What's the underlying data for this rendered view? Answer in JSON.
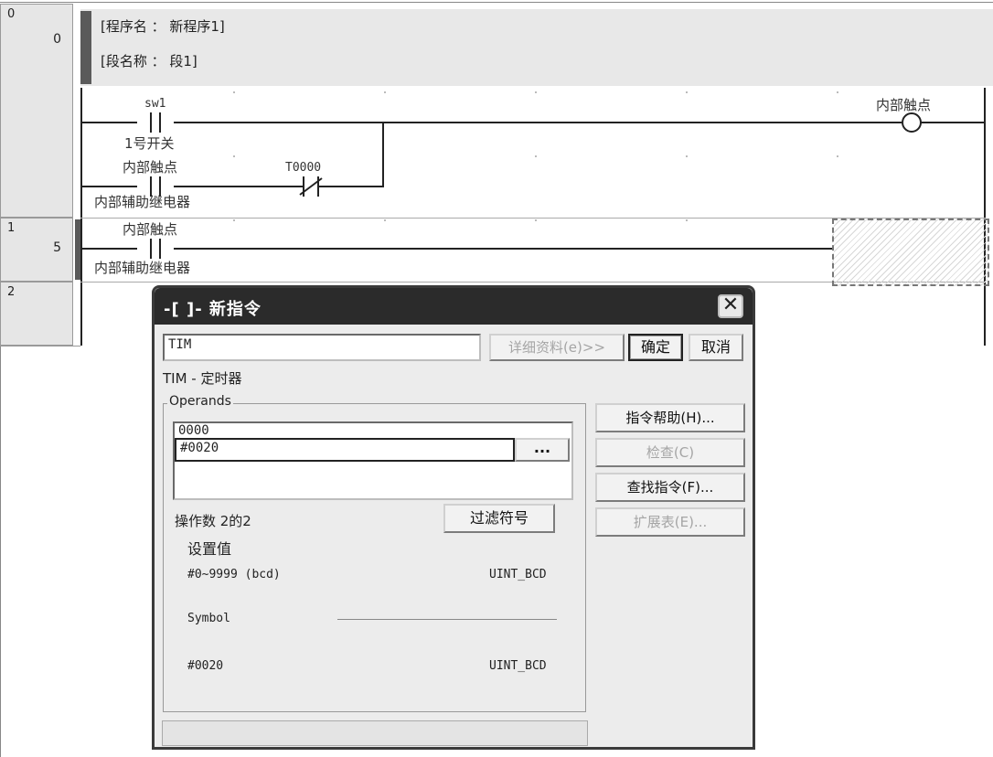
{
  "editor": {
    "rungs": [
      {
        "index": "0",
        "step": "0"
      },
      {
        "index": "1",
        "step": "5"
      },
      {
        "index": "2",
        "step": ""
      }
    ],
    "comment": {
      "program_name": "[程序名 ： 新程序1]",
      "section_name": "[段名称 ： 段1]"
    },
    "rung0": {
      "contact1_label": "sw1",
      "contact1_comment": "1号开关",
      "contact2_label": "内部触点",
      "contact2_comment": "内部辅助继电器",
      "contact3_label": "T0000",
      "coil_label": "内部触点"
    },
    "rung1": {
      "contact_label": "内部触点",
      "contact_comment": "内部辅助继电器"
    }
  },
  "dialog": {
    "title": "-[ ]- 新指令",
    "close_glyph": "✕",
    "instruction_value": "TIM",
    "details_button": "详细资料(e)>>",
    "ok_button": "确定",
    "cancel_button": "取消",
    "instruction_desc": "TIM - 定时器",
    "operands_legend": "Operands",
    "operands": [
      "0000",
      "#0020"
    ],
    "browse_button": "...",
    "operand_count": "操作数 2的2",
    "filter_button": "过滤符号",
    "setting_value_label": "设置值",
    "range": "#0~9999 (bcd)",
    "range_type": "UINT_BCD",
    "symbol_label": "Symbol",
    "current_value": "#0020",
    "current_type": "UINT_BCD",
    "side_buttons": {
      "help": "指令帮助(H)...",
      "check": "检查(C)",
      "find": "查找指令(F)...",
      "ext": "扩展表(E)..."
    }
  }
}
